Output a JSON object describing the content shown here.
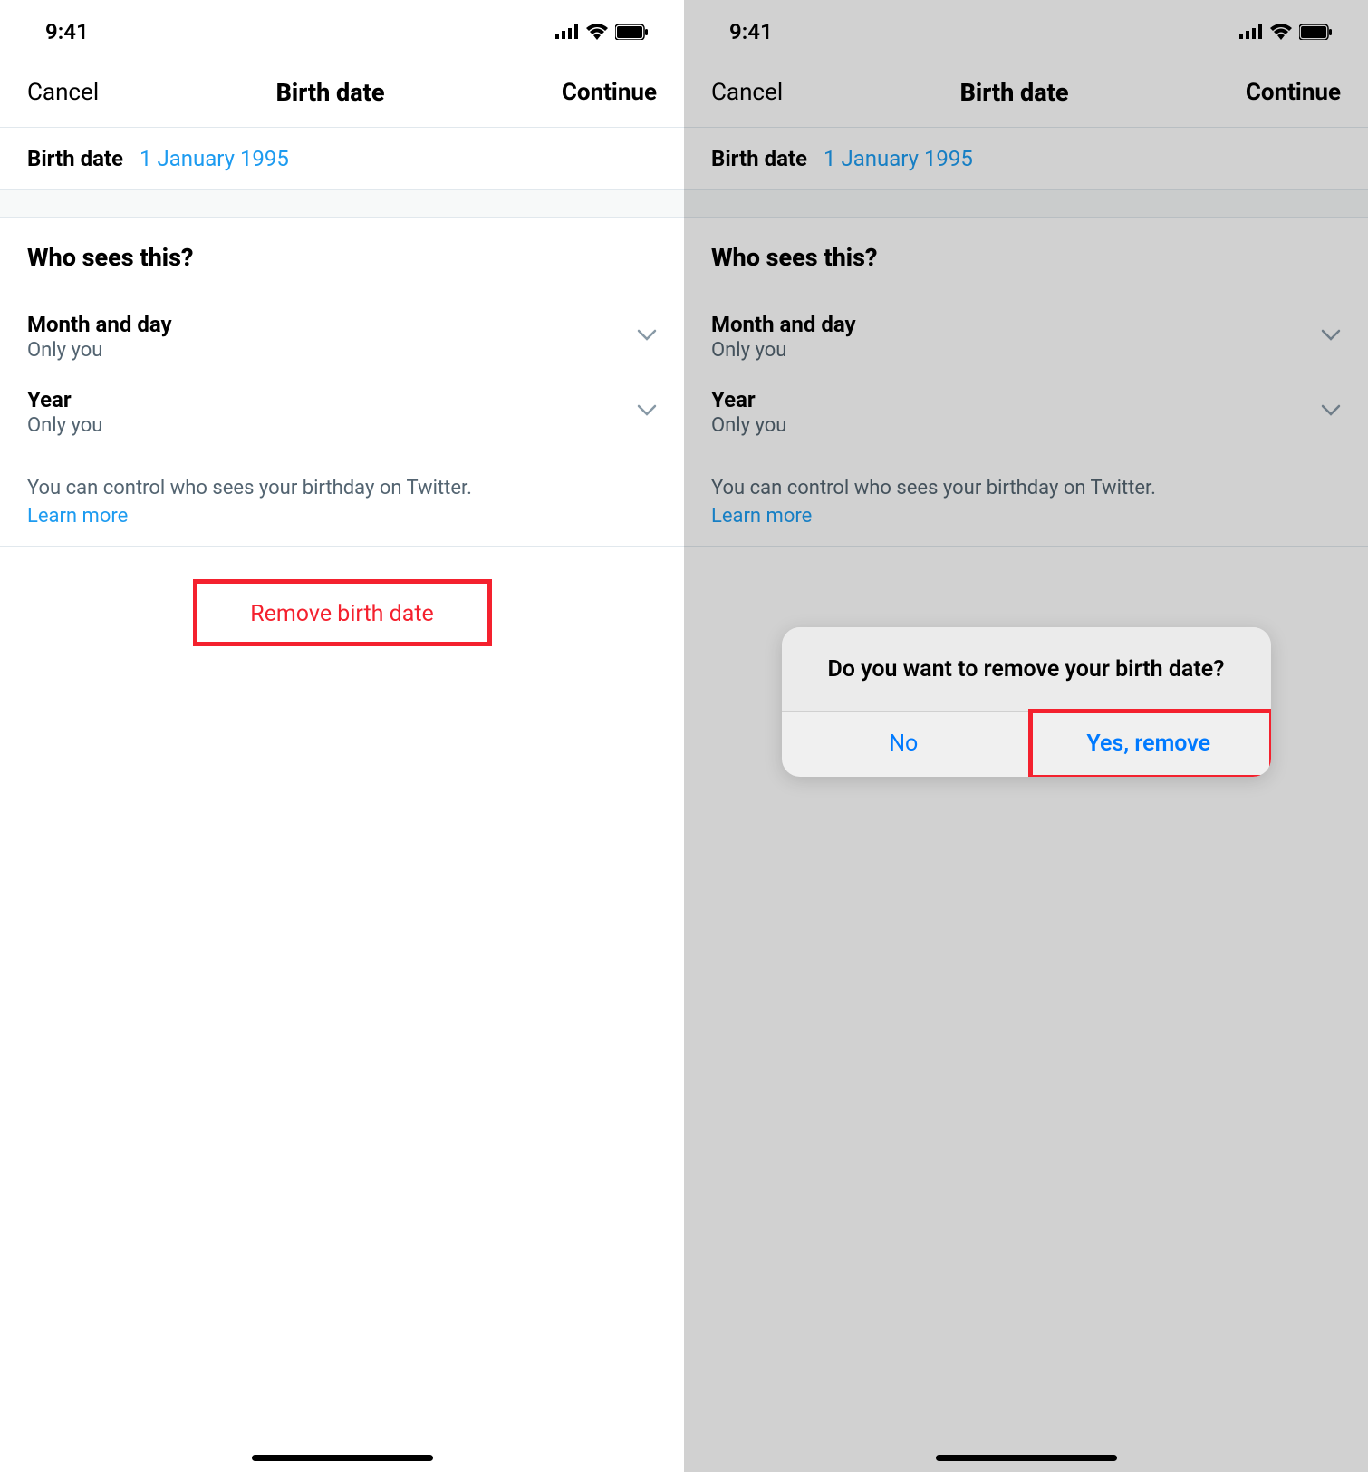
{
  "status": {
    "time": "9:41"
  },
  "nav": {
    "cancel": "Cancel",
    "title": "Birth date",
    "continue": "Continue"
  },
  "birth": {
    "label": "Birth date",
    "value": "1 January 1995"
  },
  "who": {
    "title": "Who sees this?",
    "month_day": {
      "label": "Month and day",
      "value": "Only you"
    },
    "year": {
      "label": "Year",
      "value": "Only you"
    },
    "info": "You can control who sees your birthday on Twitter.",
    "learn_more": "Learn more"
  },
  "remove": "Remove birth date",
  "dialog": {
    "title": "Do you want to remove your birth date?",
    "no": "No",
    "yes": "Yes, remove"
  }
}
